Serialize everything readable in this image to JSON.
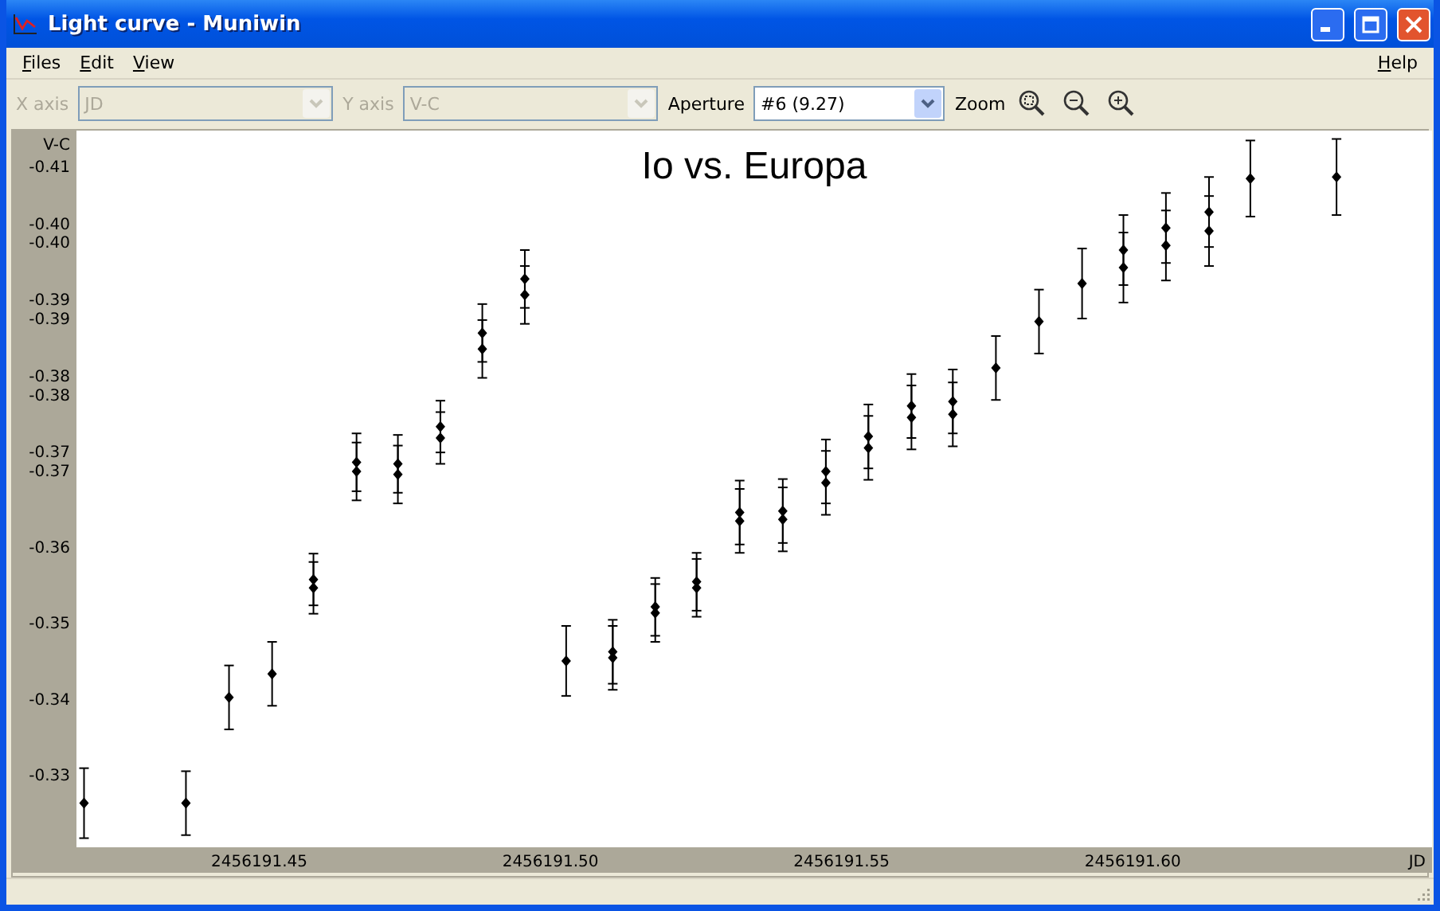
{
  "window": {
    "title": "Light curve - Muniwin"
  },
  "menu": {
    "left": [
      {
        "label": "Files"
      },
      {
        "label": "Edit"
      },
      {
        "label": "View"
      }
    ],
    "right": [
      {
        "label": "Help"
      }
    ]
  },
  "toolbar": {
    "fields": [
      {
        "label": "X axis",
        "value": "JD",
        "disabled": true,
        "kind": "combo"
      },
      {
        "label": "Y axis",
        "value": "V-C",
        "disabled": true,
        "kind": "combo"
      },
      {
        "label": "Aperture",
        "value": "#6 (9.27)",
        "disabled": false,
        "kind": "combo"
      }
    ],
    "zoom_label": "Zoom"
  },
  "chart_data": {
    "type": "scatter",
    "title": "Io vs. Europa",
    "xlabel": "JD",
    "ylabel": "V-C",
    "xlim": [
      2456191.4186,
      2456191.6514
    ],
    "ylim": [
      -0.3204,
      -0.4146
    ],
    "xticks": [
      {
        "value": 2456191.45,
        "label": "2456191.45"
      },
      {
        "value": 2456191.5,
        "label": "2456191.50"
      },
      {
        "value": 2456191.55,
        "label": "2456191.55"
      },
      {
        "value": 2456191.6,
        "label": "2456191.60"
      }
    ],
    "yticks": [
      {
        "value": -0.41,
        "label": "-0.41"
      },
      {
        "value": -0.4025,
        "label": "-0.40"
      },
      {
        "value": -0.4,
        "label": "-0.40"
      },
      {
        "value": -0.3925,
        "label": "-0.39"
      },
      {
        "value": -0.39,
        "label": "-0.39"
      },
      {
        "value": -0.3825,
        "label": "-0.38"
      },
      {
        "value": -0.38,
        "label": "-0.38"
      },
      {
        "value": -0.3725,
        "label": "-0.37"
      },
      {
        "value": -0.37,
        "label": "-0.37"
      },
      {
        "value": -0.36,
        "label": "-0.36"
      },
      {
        "value": -0.35,
        "label": "-0.35"
      },
      {
        "value": -0.34,
        "label": "-0.34"
      },
      {
        "value": -0.33,
        "label": "-0.33"
      }
    ],
    "x": [
      2456191.4199,
      2456191.4374,
      2456191.4448,
      2456191.4522,
      2456191.4593,
      2456191.4593,
      2456191.4667,
      2456191.4667,
      2456191.4738,
      2456191.4738,
      2456191.4811,
      2456191.4811,
      2456191.4883,
      2456191.4883,
      2456191.4956,
      2456191.4956,
      2456191.5027,
      2456191.5107,
      2456191.5107,
      2456191.518,
      2456191.518,
      2456191.5251,
      2456191.5251,
      2456191.5325,
      2456191.5325,
      2456191.5399,
      2456191.5399,
      2456191.5473,
      2456191.5473,
      2456191.5546,
      2456191.5546,
      2456191.562,
      2456191.562,
      2456191.5691,
      2456191.5691,
      2456191.5765,
      2456191.5839,
      2456191.5913,
      2456191.5984,
      2456191.5984,
      2456191.6057,
      2456191.6057,
      2456191.6131,
      2456191.6131,
      2456191.6202,
      2456191.635
    ],
    "series": [
      {
        "color": "#000000",
        "values": [
          -0.3262,
          -0.3262,
          -0.3401,
          -0.3432,
          -0.3556,
          -0.3545,
          -0.371,
          -0.3698,
          -0.3708,
          -0.3694,
          -0.3757,
          -0.3742,
          -0.388,
          -0.3859,
          -0.3951,
          -0.393,
          -0.3449,
          -0.3461,
          -0.3453,
          -0.352,
          -0.3512,
          -0.3553,
          -0.3545,
          -0.3644,
          -0.3633,
          -0.3646,
          -0.3635,
          -0.3698,
          -0.3683,
          -0.3744,
          -0.3729,
          -0.3784,
          -0.3769,
          -0.379,
          -0.3773,
          -0.3834,
          -0.3895,
          -0.3945,
          -0.3989,
          -0.3966,
          -0.4018,
          -0.3995,
          -0.4039,
          -0.4014,
          -0.4083,
          -0.4085
        ],
        "errors": [
          0.0046,
          0.0042,
          0.0042,
          0.0042,
          0.0034,
          0.0034,
          0.0038,
          0.0038,
          0.0038,
          0.0038,
          0.0034,
          0.0034,
          0.0038,
          0.0038,
          0.0038,
          0.0038,
          0.0046,
          0.0042,
          0.0042,
          0.0038,
          0.0038,
          0.0038,
          0.0038,
          0.0042,
          0.0042,
          0.0042,
          0.0042,
          0.0042,
          0.0042,
          0.0042,
          0.0042,
          0.0042,
          0.0042,
          0.0042,
          0.0042,
          0.0042,
          0.0042,
          0.0046,
          0.0046,
          0.0046,
          0.0046,
          0.0046,
          0.0046,
          0.0046,
          0.005,
          0.005
        ]
      }
    ]
  }
}
